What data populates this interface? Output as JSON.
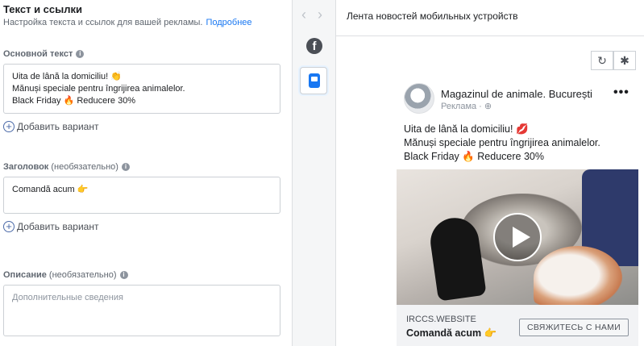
{
  "editor": {
    "section_title": "Текст и ссылки",
    "section_subtitle": "Настройка текста и ссылок для вашей рекламы.",
    "learn_more": "Подробнее",
    "primary_text": {
      "label": "Основной текст",
      "lines": [
        "Uita de lână la domiciliu! 👏",
        "Mănuși speciale pentru îngrijirea animalelor.",
        "Black Friday 🔥 Reducere 30%"
      ],
      "add_variant": "Добавить вариант"
    },
    "headline": {
      "label": "Заголовок",
      "optional": "(необязательно)",
      "value": "Comandă acum 👉",
      "add_variant": "Добавить вариант"
    },
    "description": {
      "label": "Описание",
      "optional": "(необязательно)",
      "placeholder": "Дополнительные сведения"
    }
  },
  "placements": {
    "facebook_icon": "facebook-icon",
    "mobile_icon": "mobile-feed-icon"
  },
  "preview": {
    "title": "Лента новостей мобильных устройств",
    "tools": {
      "refresh_icon": "refresh-icon",
      "bug_icon": "bug-icon"
    },
    "post": {
      "page_name": "Magazinul de animale. București",
      "sponsored": "Реклама · ⊕",
      "more": "•••",
      "text_lines": [
        "Uita de lână la domiciliu! 💋",
        "Mănuși speciale pentru îngrijirea animalelor.",
        "Black Friday 🔥 Reducere 30%"
      ],
      "domain": "IRCCS.WEBSITE",
      "headline": "Comandă acum 👉",
      "cta": "СВЯЖИТЕСЬ С НАМИ"
    }
  }
}
